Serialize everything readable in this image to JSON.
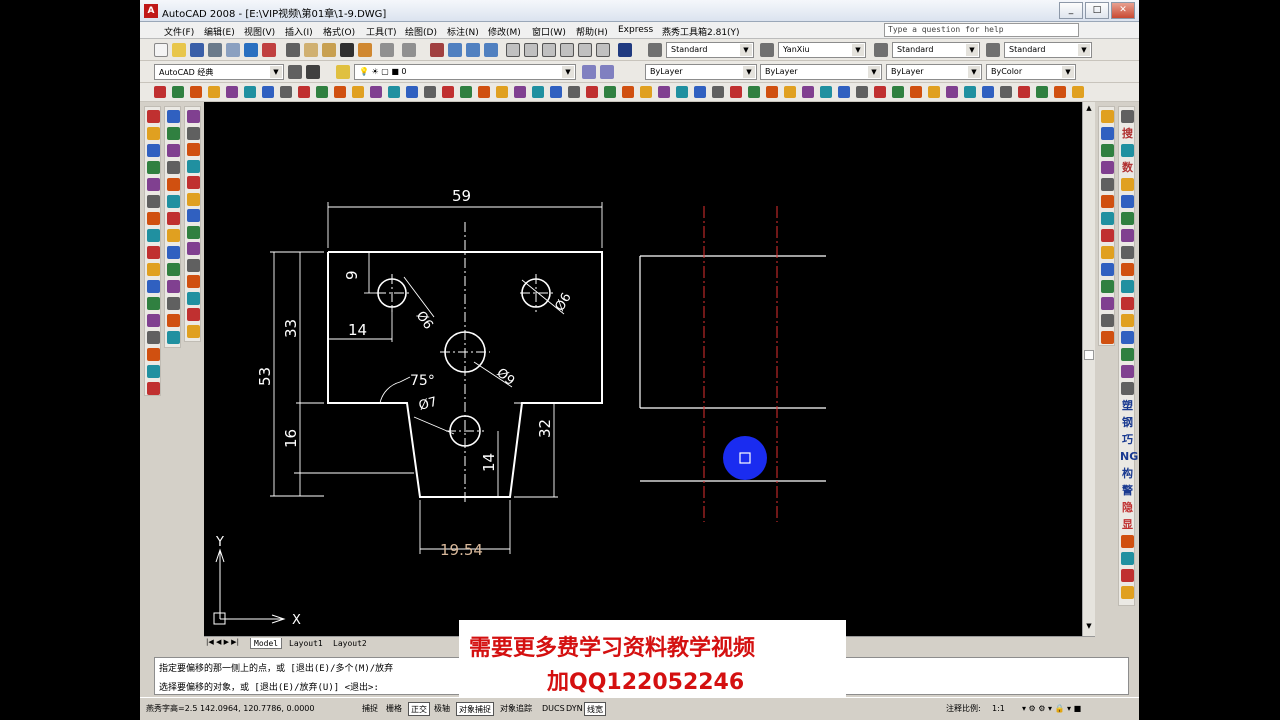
{
  "window": {
    "title": "AutoCAD 2008 - [E:\\VIP视频\\第01章\\1-9.DWG]",
    "app_icon": "autocad-logo-icon",
    "min": "_",
    "max": "□",
    "close": "✕"
  },
  "menu": {
    "items": [
      "文件(F)",
      "编辑(E)",
      "视图(V)",
      "插入(I)",
      "格式(O)",
      "工具(T)",
      "绘图(D)",
      "标注(N)",
      "修改(M)",
      "窗口(W)",
      "帮助(H)",
      "Express",
      "燕秀工具箱2.81(Y)"
    ],
    "help_placeholder": "Type a question for help"
  },
  "styles": {
    "text_style": "Standard",
    "dim_style": "YanXiu",
    "table_style": "Standard",
    "mleader_style": "Standard"
  },
  "workspace": {
    "name": "AutoCAD 经典",
    "layer": "0"
  },
  "properties": {
    "color": "ByLayer",
    "linetype": "ByLayer",
    "lineweight": "ByLayer",
    "plotstyle": "ByColor"
  },
  "drawing": {
    "dims": {
      "d59": "59",
      "d9": "9",
      "d14a": "14",
      "d33": "33",
      "d53": "53",
      "d16": "16",
      "d32": "32",
      "d14b": "14",
      "d1954": "19.54",
      "a75": "75°",
      "p6a": "Ø6",
      "p6b": "Ø6",
      "p9": "Ø9",
      "p7": "Ø7"
    },
    "ucs": {
      "x": "X",
      "y": "Y"
    }
  },
  "tabs": [
    "Model",
    "Layout1",
    "Layout2"
  ],
  "cmd": {
    "line1": "指定要偏移的那一侧上的点，或 [退出(E)/多个(M)/放弃",
    "line2": "选择要偏移的对象，或 [退出(E)/放弃(U)] <退出>:"
  },
  "status": {
    "coords": "燕秀字高=2.5  142.0964, 120.7786, 0.0000",
    "buttons": [
      {
        "label": "捕捉",
        "on": false
      },
      {
        "label": "栅格",
        "on": false
      },
      {
        "label": "正交",
        "on": true
      },
      {
        "label": "极轴",
        "on": false
      },
      {
        "label": "对象捕捉",
        "on": true
      },
      {
        "label": "对象追踪",
        "on": false
      },
      {
        "label": "DUCS",
        "on": false
      },
      {
        "label": "DYN",
        "on": false
      },
      {
        "label": "线宽",
        "on": true
      }
    ],
    "scale_label": "注释比例:",
    "scale": "1:1"
  },
  "sidebar_labels": [
    "搜",
    "数",
    "塑",
    "钢",
    "巧",
    "NG",
    "构",
    "警",
    "隐",
    "显",
    "块"
  ],
  "ad": {
    "line1": "需要更多费学习资料教学视频",
    "line2": "加QQ122052246"
  }
}
